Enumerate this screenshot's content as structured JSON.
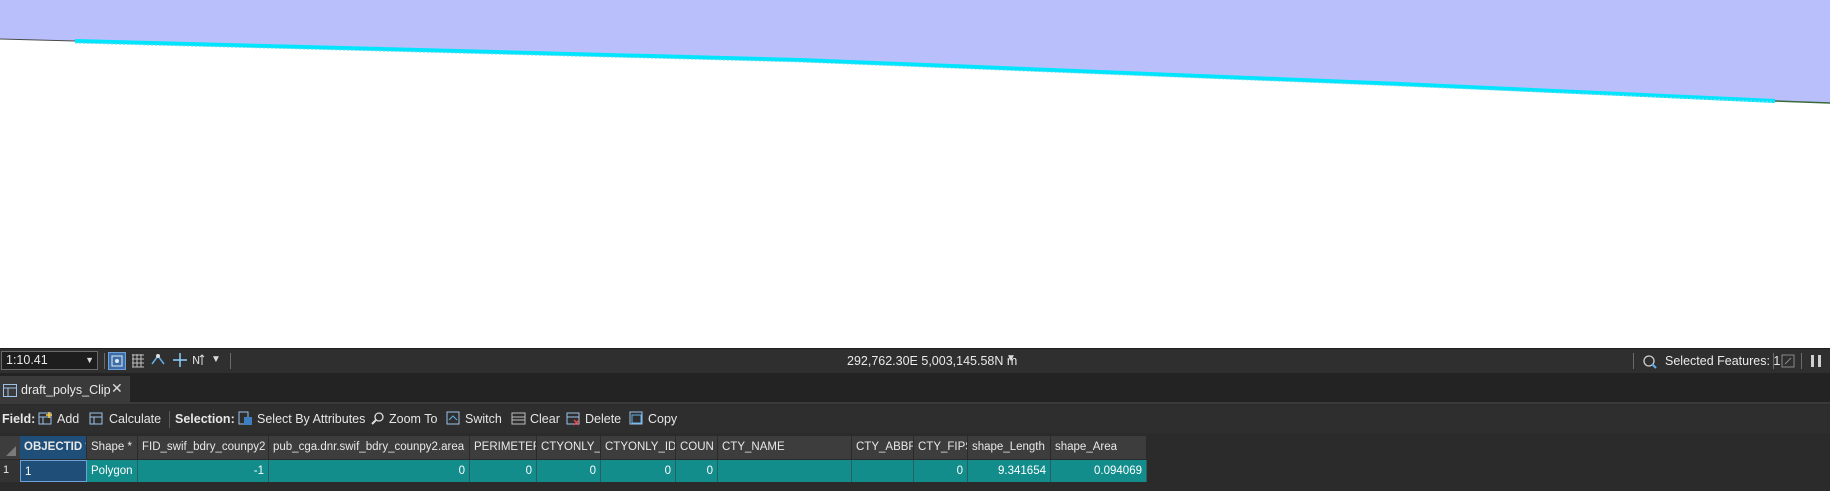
{
  "colors": {
    "polygon_fill": "#b8bffa",
    "polygon_edge": "#00e5ff",
    "selection_row": "#138c8c",
    "objectid_header": "#1f4e79"
  },
  "statusbar": {
    "scale": "1:10.41",
    "coordinates": "292,762.30E 5,003,145.58N m",
    "selected_features": "Selected Features: 1"
  },
  "table_tab": {
    "label": "draft_polys_Clip",
    "close_glyph": "✕"
  },
  "toolbar": {
    "field_label": "Field:",
    "add_label": "Add",
    "calculate_label": "Calculate",
    "selection_label": "Selection:",
    "select_by_attributes_label": "Select By Attributes",
    "zoom_to_label": "Zoom To",
    "switch_label": "Switch",
    "clear_label": "Clear",
    "delete_label": "Delete",
    "copy_label": "Copy"
  },
  "table": {
    "columns": [
      "OBJECTID *",
      "Shape *",
      "FID_swif_bdry_counpy2",
      "pub_cga.dnr.swif_bdry_counpy2.area",
      "PERIMETER",
      "CTYONLY_",
      "CTYONLY_ID",
      "COUN",
      "CTY_NAME",
      "CTY_ABBR",
      "CTY_FIPS",
      "shape_Length",
      "shape_Area"
    ],
    "rows": [
      {
        "row_number": "1",
        "cells": [
          "1",
          "Polygon",
          "-1",
          "0",
          "0",
          "0",
          "0",
          "0",
          "",
          "",
          "0",
          "9.341654",
          "0.094069"
        ]
      }
    ]
  }
}
